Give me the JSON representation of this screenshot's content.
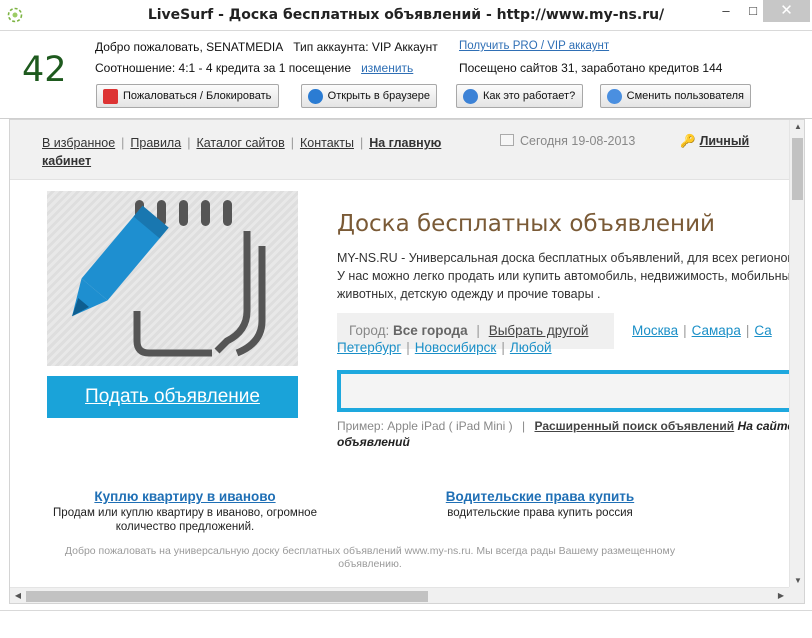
{
  "window": {
    "title": "LiveSurf - Доска бесплатных объявлений - http://www.my-ns.ru/",
    "minimize": "–",
    "maximize": "□",
    "close": "✕"
  },
  "topbar": {
    "counter": "42",
    "welcome": "Добро пожаловать, SENATMEDIA",
    "account_type": "Тип аккаунта: VIP Аккаунт",
    "get_pro_link": "Получить PRO / VIP аккаунт",
    "ratio": "Соотношение: 4:1 - 4 кредита за 1 посещение",
    "change_link": "изменить",
    "visited": "Посещено сайтов 31, заработано кредитов 144",
    "buttons": {
      "complain": "Пожаловаться / Блокировать",
      "open_browser": "Открыть в браузере",
      "how_it_works": "Как это работает?",
      "switch_user": "Сменить пользователя"
    }
  },
  "page": {
    "nav": {
      "favorites": "В избранное",
      "rules": "Правила",
      "catalog": "Каталог сайтов",
      "contacts": "Контакты",
      "home": "На главную"
    },
    "date": "Сегодня 19-08-2013",
    "cabinet_line1": "Личный",
    "cabinet_line2": "кабинет",
    "cta": "Подать объявление",
    "title": "Доска бесплатных объявлений",
    "desc_line1": "MY-NS.RU - Универсальная доска бесплатных объявлений, для всех регионов",
    "desc_line2": "У нас можно легко продать или купить автомобиль, недвижимость, мобильный",
    "desc_line3": "животных, детскую одежду и прочие товары .",
    "city_label": "Город:",
    "city_value": "Все города",
    "city_change": "Выбрать другой",
    "cities": {
      "moscow": "Москва",
      "samara": "Самара",
      "spb_start": "Са",
      "spb_end": "Петербург",
      "novosibirsk": "Новосибирск",
      "any": "Любой"
    },
    "search_placeholder": "",
    "example": "Пример: Apple iPad ( iPad Mini )",
    "advanced_search": "Расширенный поиск объявлений",
    "on_site_1": "На сайте",
    "on_site_2": "объявлений",
    "ads": [
      {
        "title": "Куплю квартиру в иваново",
        "line1": "Продам или куплю квартиру в иваново, огромное",
        "line2": "количество предложений."
      },
      {
        "title": "Водительские права купить",
        "line1": "водительские права купить россия",
        "line2": ""
      }
    ],
    "footer_line1": "Добро пожаловать на универсальную доску бесплатных объявлений www.my-ns.ru. Мы всегда рады Вашему размещенному",
    "footer_line2": "объявлению."
  },
  "colors": {
    "accent": "#1aa3d9",
    "title_brown": "#7a5a36",
    "counter_green": "#1e5a1e",
    "link_blue": "#2f6fb5"
  }
}
